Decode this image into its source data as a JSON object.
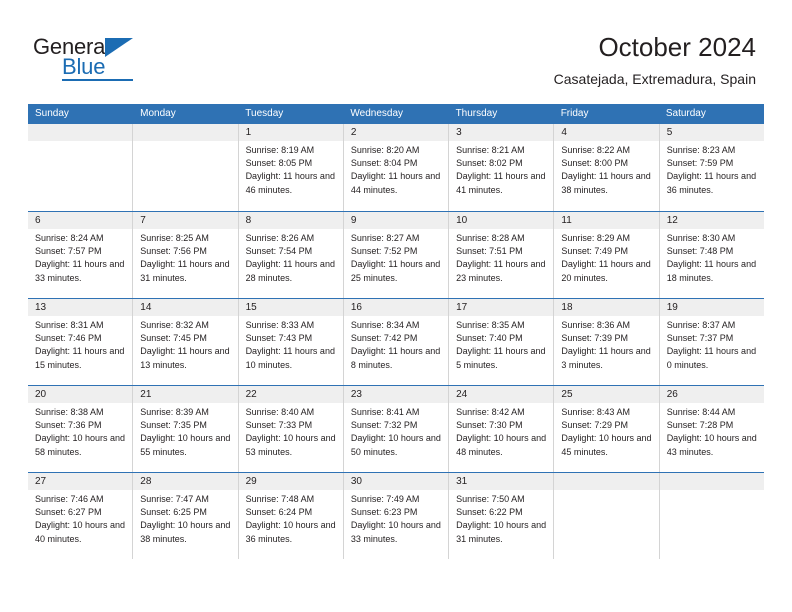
{
  "brand": {
    "name_top": "General",
    "name_bottom": "Blue",
    "accent_color": "#1b6cb3"
  },
  "header": {
    "title": "October 2024",
    "subtitle": "Casatejada, Extremadura, Spain"
  },
  "calendar": {
    "header_color": "#2f72b4",
    "day_strip_color": "#efefef",
    "weekday_labels": [
      "Sunday",
      "Monday",
      "Tuesday",
      "Wednesday",
      "Thursday",
      "Friday",
      "Saturday"
    ],
    "weeks": [
      [
        {
          "date": "",
          "sunrise": "",
          "sunset": "",
          "daylight": "",
          "empty": true
        },
        {
          "date": "",
          "sunrise": "",
          "sunset": "",
          "daylight": "",
          "empty": true
        },
        {
          "date": "1",
          "sunrise": "Sunrise: 8:19 AM",
          "sunset": "Sunset: 8:05 PM",
          "daylight": "Daylight: 11 hours and 46 minutes."
        },
        {
          "date": "2",
          "sunrise": "Sunrise: 8:20 AM",
          "sunset": "Sunset: 8:04 PM",
          "daylight": "Daylight: 11 hours and 44 minutes."
        },
        {
          "date": "3",
          "sunrise": "Sunrise: 8:21 AM",
          "sunset": "Sunset: 8:02 PM",
          "daylight": "Daylight: 11 hours and 41 minutes."
        },
        {
          "date": "4",
          "sunrise": "Sunrise: 8:22 AM",
          "sunset": "Sunset: 8:00 PM",
          "daylight": "Daylight: 11 hours and 38 minutes."
        },
        {
          "date": "5",
          "sunrise": "Sunrise: 8:23 AM",
          "sunset": "Sunset: 7:59 PM",
          "daylight": "Daylight: 11 hours and 36 minutes."
        }
      ],
      [
        {
          "date": "6",
          "sunrise": "Sunrise: 8:24 AM",
          "sunset": "Sunset: 7:57 PM",
          "daylight": "Daylight: 11 hours and 33 minutes."
        },
        {
          "date": "7",
          "sunrise": "Sunrise: 8:25 AM",
          "sunset": "Sunset: 7:56 PM",
          "daylight": "Daylight: 11 hours and 31 minutes."
        },
        {
          "date": "8",
          "sunrise": "Sunrise: 8:26 AM",
          "sunset": "Sunset: 7:54 PM",
          "daylight": "Daylight: 11 hours and 28 minutes."
        },
        {
          "date": "9",
          "sunrise": "Sunrise: 8:27 AM",
          "sunset": "Sunset: 7:52 PM",
          "daylight": "Daylight: 11 hours and 25 minutes."
        },
        {
          "date": "10",
          "sunrise": "Sunrise: 8:28 AM",
          "sunset": "Sunset: 7:51 PM",
          "daylight": "Daylight: 11 hours and 23 minutes."
        },
        {
          "date": "11",
          "sunrise": "Sunrise: 8:29 AM",
          "sunset": "Sunset: 7:49 PM",
          "daylight": "Daylight: 11 hours and 20 minutes."
        },
        {
          "date": "12",
          "sunrise": "Sunrise: 8:30 AM",
          "sunset": "Sunset: 7:48 PM",
          "daylight": "Daylight: 11 hours and 18 minutes."
        }
      ],
      [
        {
          "date": "13",
          "sunrise": "Sunrise: 8:31 AM",
          "sunset": "Sunset: 7:46 PM",
          "daylight": "Daylight: 11 hours and 15 minutes."
        },
        {
          "date": "14",
          "sunrise": "Sunrise: 8:32 AM",
          "sunset": "Sunset: 7:45 PM",
          "daylight": "Daylight: 11 hours and 13 minutes."
        },
        {
          "date": "15",
          "sunrise": "Sunrise: 8:33 AM",
          "sunset": "Sunset: 7:43 PM",
          "daylight": "Daylight: 11 hours and 10 minutes."
        },
        {
          "date": "16",
          "sunrise": "Sunrise: 8:34 AM",
          "sunset": "Sunset: 7:42 PM",
          "daylight": "Daylight: 11 hours and 8 minutes."
        },
        {
          "date": "17",
          "sunrise": "Sunrise: 8:35 AM",
          "sunset": "Sunset: 7:40 PM",
          "daylight": "Daylight: 11 hours and 5 minutes."
        },
        {
          "date": "18",
          "sunrise": "Sunrise: 8:36 AM",
          "sunset": "Sunset: 7:39 PM",
          "daylight": "Daylight: 11 hours and 3 minutes."
        },
        {
          "date": "19",
          "sunrise": "Sunrise: 8:37 AM",
          "sunset": "Sunset: 7:37 PM",
          "daylight": "Daylight: 11 hours and 0 minutes."
        }
      ],
      [
        {
          "date": "20",
          "sunrise": "Sunrise: 8:38 AM",
          "sunset": "Sunset: 7:36 PM",
          "daylight": "Daylight: 10 hours and 58 minutes."
        },
        {
          "date": "21",
          "sunrise": "Sunrise: 8:39 AM",
          "sunset": "Sunset: 7:35 PM",
          "daylight": "Daylight: 10 hours and 55 minutes."
        },
        {
          "date": "22",
          "sunrise": "Sunrise: 8:40 AM",
          "sunset": "Sunset: 7:33 PM",
          "daylight": "Daylight: 10 hours and 53 minutes."
        },
        {
          "date": "23",
          "sunrise": "Sunrise: 8:41 AM",
          "sunset": "Sunset: 7:32 PM",
          "daylight": "Daylight: 10 hours and 50 minutes."
        },
        {
          "date": "24",
          "sunrise": "Sunrise: 8:42 AM",
          "sunset": "Sunset: 7:30 PM",
          "daylight": "Daylight: 10 hours and 48 minutes."
        },
        {
          "date": "25",
          "sunrise": "Sunrise: 8:43 AM",
          "sunset": "Sunset: 7:29 PM",
          "daylight": "Daylight: 10 hours and 45 minutes."
        },
        {
          "date": "26",
          "sunrise": "Sunrise: 8:44 AM",
          "sunset": "Sunset: 7:28 PM",
          "daylight": "Daylight: 10 hours and 43 minutes."
        }
      ],
      [
        {
          "date": "27",
          "sunrise": "Sunrise: 7:46 AM",
          "sunset": "Sunset: 6:27 PM",
          "daylight": "Daylight: 10 hours and 40 minutes."
        },
        {
          "date": "28",
          "sunrise": "Sunrise: 7:47 AM",
          "sunset": "Sunset: 6:25 PM",
          "daylight": "Daylight: 10 hours and 38 minutes."
        },
        {
          "date": "29",
          "sunrise": "Sunrise: 7:48 AM",
          "sunset": "Sunset: 6:24 PM",
          "daylight": "Daylight: 10 hours and 36 minutes."
        },
        {
          "date": "30",
          "sunrise": "Sunrise: 7:49 AM",
          "sunset": "Sunset: 6:23 PM",
          "daylight": "Daylight: 10 hours and 33 minutes."
        },
        {
          "date": "31",
          "sunrise": "Sunrise: 7:50 AM",
          "sunset": "Sunset: 6:22 PM",
          "daylight": "Daylight: 10 hours and 31 minutes."
        },
        {
          "date": "",
          "sunrise": "",
          "sunset": "",
          "daylight": "",
          "empty": true
        },
        {
          "date": "",
          "sunrise": "",
          "sunset": "",
          "daylight": "",
          "empty": true
        }
      ]
    ]
  }
}
